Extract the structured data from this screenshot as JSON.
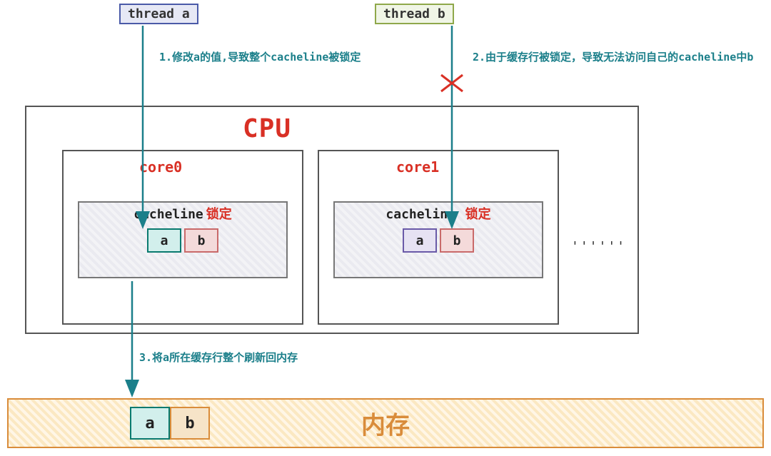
{
  "threads": {
    "a": {
      "label": "thread a"
    },
    "b": {
      "label": "thread b"
    }
  },
  "cpu": {
    "label": "CPU",
    "ellipsis": "''''''",
    "core0": {
      "label": "core0",
      "cacheline_label": "cacheline",
      "lock_label": "锁定",
      "cell_a": "a",
      "cell_b": "b"
    },
    "core1": {
      "label": "core1",
      "cacheline_label": "cacheline",
      "lock_label": "锁定",
      "cell_a": "a",
      "cell_b": "b"
    }
  },
  "memory": {
    "label": "内存",
    "cell_a": "a",
    "cell_b": "b"
  },
  "annotations": {
    "step1": "1.修改a的值,导致整个cacheline被锁定",
    "step2": "2.由于缓存行被锁定，导致无法访问自己的cacheline中b",
    "step3": "3.将a所在缓存行整个刷新回内存"
  },
  "colors": {
    "accent_red": "#d93025",
    "teal": "#1b7f8a",
    "orange": "#d98c3a",
    "purple": "#6a5aa8",
    "green": "#8fa84a",
    "blue": "#4a5aa8"
  }
}
